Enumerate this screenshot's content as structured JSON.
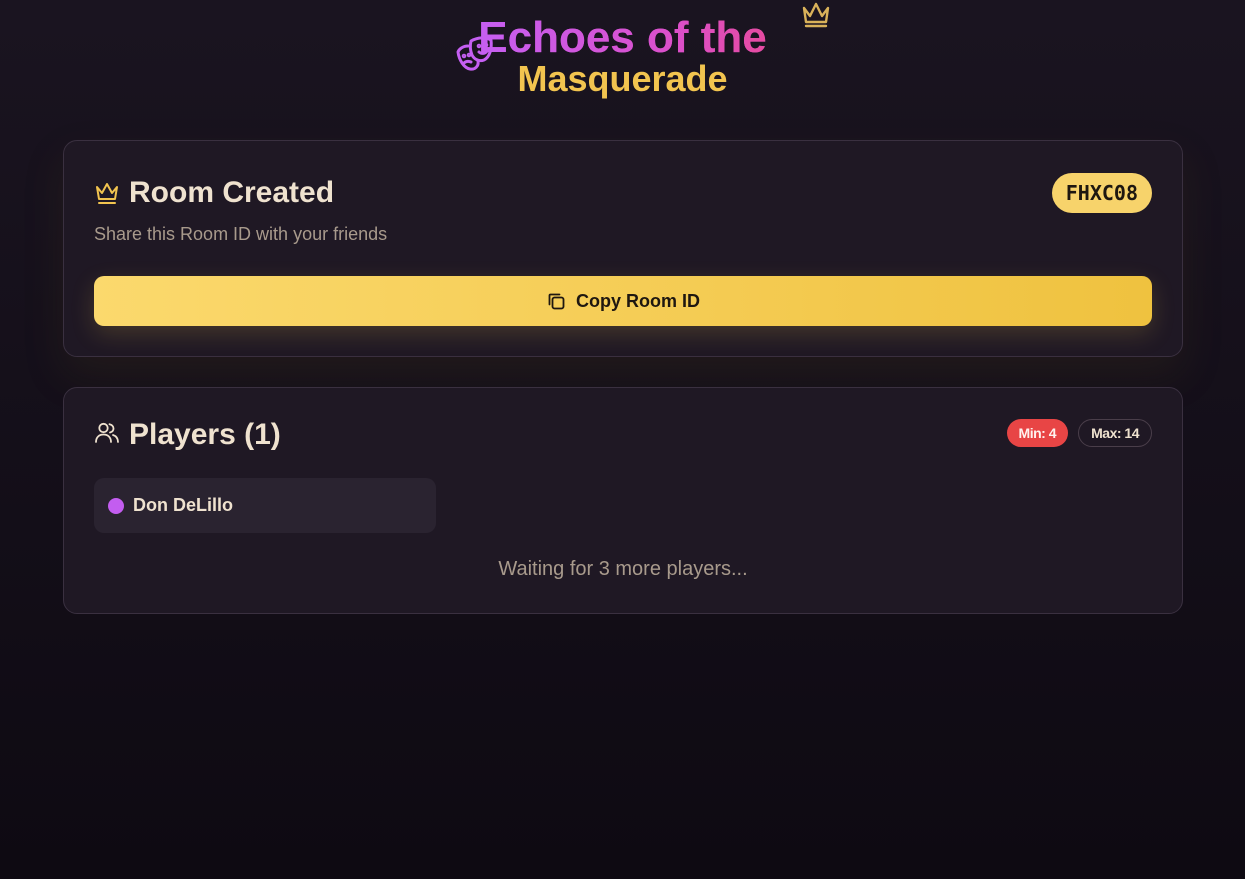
{
  "header": {
    "title_line1": "Echoes of the",
    "title_line2": "Masquerade",
    "mask_icon": "theater-mask-icon",
    "crown_icon": "crown-icon"
  },
  "room": {
    "title": "Room Created",
    "subtitle": "Share this Room ID with your friends",
    "room_id": "FHXC08",
    "copy_label": "Copy Room ID",
    "title_icon": "crown-icon",
    "copy_icon": "copy-icon"
  },
  "players": {
    "title": "Players (1)",
    "title_icon": "users-icon",
    "min_label": "Min: 4",
    "max_label": "Max: 14",
    "list": [
      {
        "name": "Don DeLillo",
        "color": "#c35df0"
      }
    ],
    "waiting_text": "Waiting for 3 more players..."
  },
  "colors": {
    "accent_gold": "#f2c44f",
    "accent_purple": "#c95ef0",
    "min_badge": "#e84545",
    "background": "#15101a"
  }
}
